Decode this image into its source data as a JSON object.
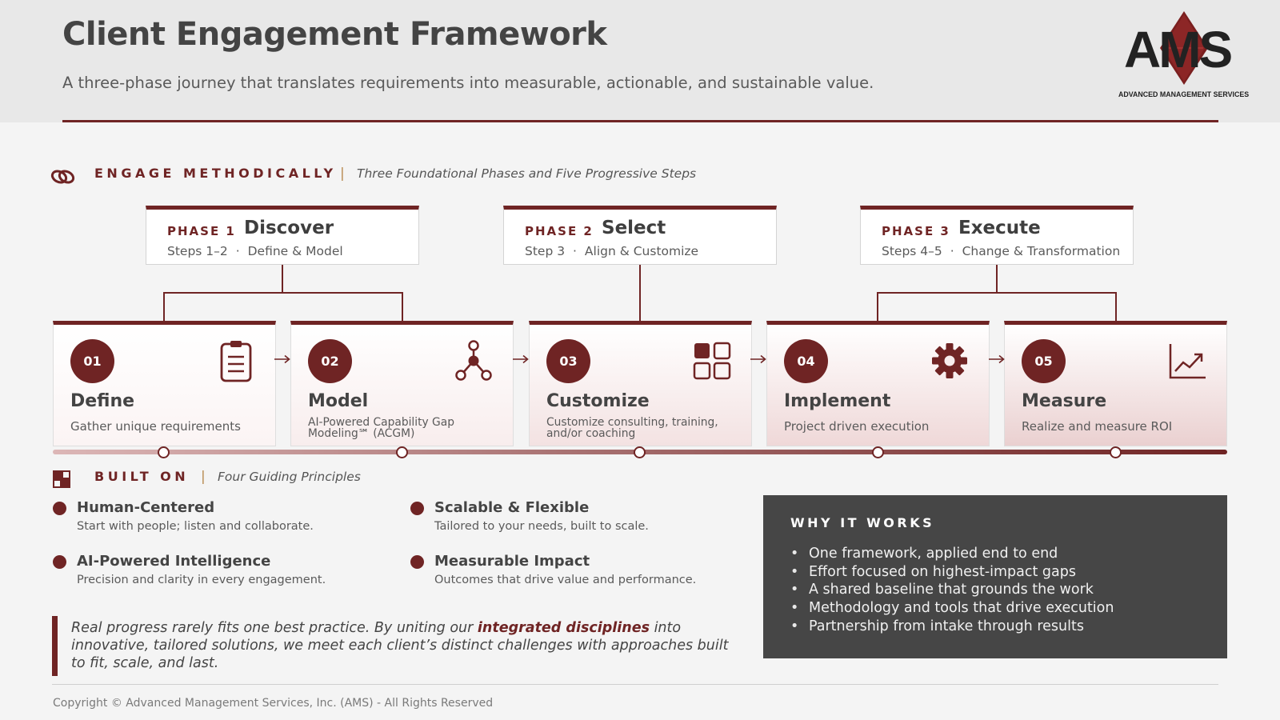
{
  "header": {
    "title": "Client Engagement Framework",
    "subtitle": "A three-phase journey that translates requirements into measurable, actionable, and sustainable value.",
    "logo_text": "AMS",
    "logo_subtext": "ADVANCED MANAGEMENT SERVICES"
  },
  "section1": {
    "label": "ENGAGE METHODICALLY",
    "separator": "|",
    "description": "Three Foundational Phases and Five Progressive Steps",
    "icon": "link-rings-icon"
  },
  "phases": [
    {
      "number": "PHASE 1",
      "name": "Discover",
      "steps": "Steps 1–2",
      "dot": "·",
      "summary": "Define & Model"
    },
    {
      "number": "PHASE 2",
      "name": "Select",
      "steps": "Step 3",
      "dot": "·",
      "summary": "Align & Customize"
    },
    {
      "number": "PHASE 3",
      "name": "Execute",
      "steps": "Steps 4–5",
      "dot": "·",
      "summary": "Change & Transformation"
    }
  ],
  "steps": [
    {
      "number": "01",
      "title": "Define",
      "description": "Gather unique requirements",
      "icon": "clipboard-icon"
    },
    {
      "number": "02",
      "title": "Model",
      "description": "AI-Powered Capability Gap Modeling℠ (ACGM)",
      "icon": "network-nodes-icon"
    },
    {
      "number": "03",
      "title": "Customize",
      "description": "Customize consulting, training, and/or coaching",
      "icon": "grid-squares-icon"
    },
    {
      "number": "04",
      "title": "Implement",
      "description": "Project driven execution",
      "icon": "gear-icon"
    },
    {
      "number": "05",
      "title": "Measure",
      "description": "Realize and measure ROI",
      "icon": "line-chart-icon"
    }
  ],
  "section2": {
    "label": "BUILT ON",
    "separator": "|",
    "description": "Four Guiding Principles",
    "icon": "blocks-icon"
  },
  "principles": [
    {
      "title": "Human-Centered",
      "description": "Start with people; listen and collaborate."
    },
    {
      "title": "Scalable & Flexible",
      "description": "Tailored to your needs, built to scale."
    },
    {
      "title": "AI-Powered Intelligence",
      "description": "Precision and clarity in every engagement."
    },
    {
      "title": "Measurable Impact",
      "description": "Outcomes that drive value and performance."
    }
  ],
  "quote": {
    "before": "Real progress rarely fits one best practice. By uniting our ",
    "highlight": "integrated disciplines",
    "after": " into innovative, tailored solutions, we meet each client’s distinct challenges with approaches built to fit, scale, and last."
  },
  "why": {
    "title": "WHY IT WORKS",
    "items": [
      "One framework, applied end to end",
      "Effort focused on highest-impact gaps",
      "A shared baseline that grounds the work",
      "Methodology and tools that drive execution",
      "Partnership from intake through results"
    ]
  },
  "footer": {
    "copyright": "Copyright © Advanced Management Services, Inc. (AMS) - All Rights Reserved"
  },
  "colors": {
    "accent": "#6f2424",
    "dark_panel": "#464646",
    "background": "#f4f4f4"
  }
}
